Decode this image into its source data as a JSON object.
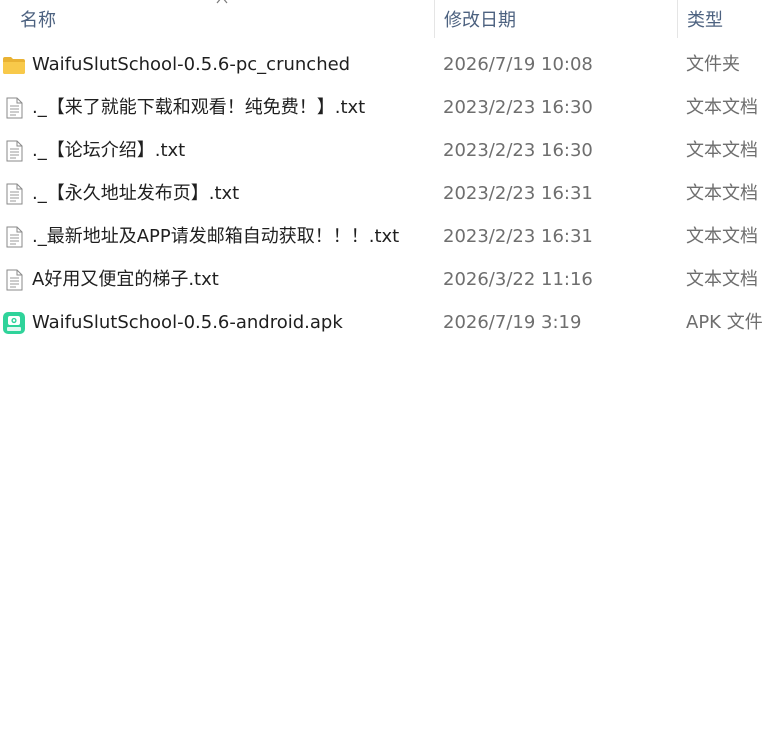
{
  "header": {
    "name_label": "名称",
    "date_label": "修改日期",
    "type_label": "类型"
  },
  "files": [
    {
      "name": "WaifuSlutSchool-0.5.6-pc_crunched",
      "date": "2026/7/19 10:08",
      "type": "文件夹",
      "icon": "folder-icon"
    },
    {
      "name": "._【来了就能下载和观看！纯免费！】.txt",
      "date": "2023/2/23 16:30",
      "type": "文本文档",
      "icon": "text-document-icon"
    },
    {
      "name": "._【论坛介绍】.txt",
      "date": "2023/2/23 16:30",
      "type": "文本文档",
      "icon": "text-document-icon"
    },
    {
      "name": "._【永久地址发布页】.txt",
      "date": "2023/2/23 16:31",
      "type": "文本文档",
      "icon": "text-document-icon"
    },
    {
      "name": "._最新地址及APP请发邮箱自动获取！！！.txt",
      "date": "2023/2/23 16:31",
      "type": "文本文档",
      "icon": "text-document-icon"
    },
    {
      "name": "A好用又便宜的梯子.txt",
      "date": "2026/3/22 11:16",
      "type": "文本文档",
      "icon": "text-document-icon"
    },
    {
      "name": "WaifuSlutSchool-0.5.6-android.apk",
      "date": "2026/7/19 3:19",
      "type": "APK 文件",
      "icon": "apk-icon"
    }
  ],
  "colors": {
    "header_text": "#4d6280",
    "name_text": "#1f1f1f",
    "meta_text": "#6e6e6e",
    "folder": "#f8c94a",
    "apk_green": "#2fd39a"
  }
}
